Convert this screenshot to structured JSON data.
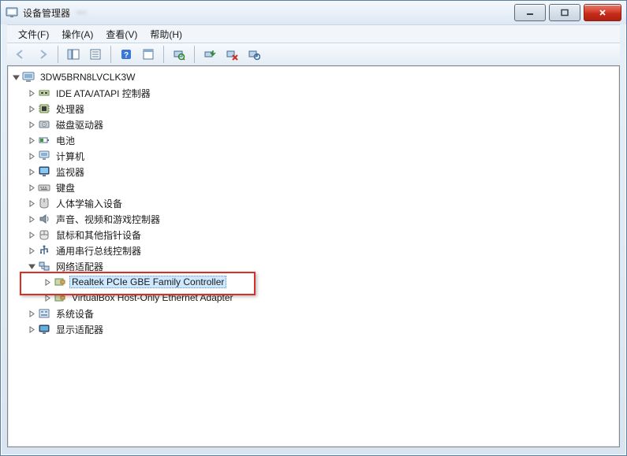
{
  "window": {
    "title": "设备管理器",
    "obscured_title_hint": "•••"
  },
  "menu": {
    "file": "文件(F)",
    "action": "操作(A)",
    "view": "查看(V)",
    "help": "帮助(H)"
  },
  "toolbar": {
    "back": "后退",
    "forward": "前进",
    "show_hide_tree": "显示/隐藏控制台树",
    "properties_sheet": "属性",
    "help": "帮助",
    "action_properties": "属性",
    "scan_hardware": "扫描检测硬件改动",
    "update_driver": "更新驱动程序",
    "uninstall": "卸载",
    "disable": "禁用"
  },
  "tree": {
    "root": "3DW5BRN8LVCLK3W",
    "nodes": [
      {
        "label": "IDE ATA/ATAPI 控制器",
        "icon": "ide"
      },
      {
        "label": "处理器",
        "icon": "cpu"
      },
      {
        "label": "磁盘驱动器",
        "icon": "disk"
      },
      {
        "label": "电池",
        "icon": "battery"
      },
      {
        "label": "计算机",
        "icon": "computer"
      },
      {
        "label": "监视器",
        "icon": "monitor"
      },
      {
        "label": "键盘",
        "icon": "keyboard"
      },
      {
        "label": "人体学输入设备",
        "icon": "hid"
      },
      {
        "label": "声音、视频和游戏控制器",
        "icon": "sound"
      },
      {
        "label": "鼠标和其他指针设备",
        "icon": "mouse"
      },
      {
        "label": "通用串行总线控制器",
        "icon": "usb"
      },
      {
        "label": "网络适配器",
        "icon": "network",
        "expanded": true,
        "children": [
          {
            "label": "Realtek PCIe GBE Family Controller",
            "icon": "nic",
            "selected": true,
            "highlighted": true
          },
          {
            "label": "VirtualBox Host-Only Ethernet Adapter",
            "icon": "nic"
          }
        ]
      },
      {
        "label": "系统设备",
        "icon": "system"
      },
      {
        "label": "显示适配器",
        "icon": "display"
      }
    ]
  }
}
